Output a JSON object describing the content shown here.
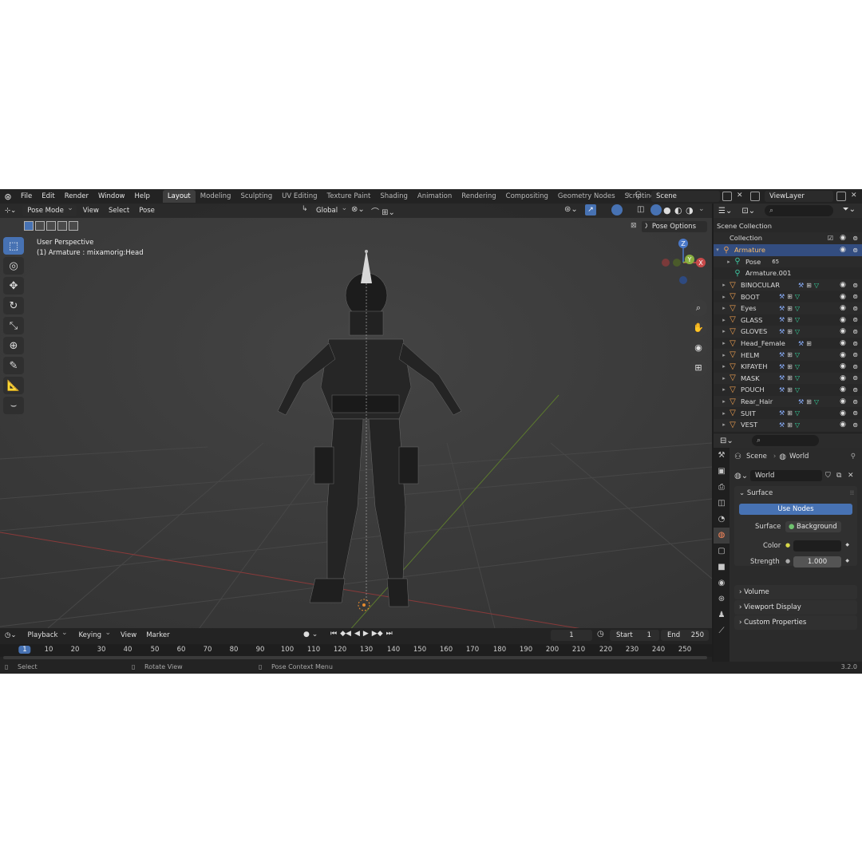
{
  "menu": [
    "File",
    "Edit",
    "Render",
    "Window",
    "Help"
  ],
  "workspaces": [
    "Layout",
    "Modeling",
    "Sculpting",
    "UV Editing",
    "Texture Paint",
    "Shading",
    "Animation",
    "Rendering",
    "Compositing",
    "Geometry Nodes",
    "Scripting"
  ],
  "scene_name": "Scene",
  "view_layer": "ViewLayer",
  "viewport": {
    "mode": "Pose Mode",
    "menus": [
      "View",
      "Select",
      "Pose"
    ],
    "transform_orientation": "Global",
    "perspective_label": "User Perspective",
    "active_bone_label": "(1) Armature : mixamorig:Head",
    "pose_options": "Pose Options",
    "x_label": "X",
    "gizmo_axes": {
      "z": "Z",
      "y": "Y",
      "x": "X"
    }
  },
  "outliner": {
    "root": "Scene Collection",
    "collection": "Collection",
    "rows": [
      {
        "label": "Armature",
        "kind": "armature",
        "selected": true
      },
      {
        "label": "Pose",
        "kind": "pose",
        "badge": "65"
      },
      {
        "label": "Armature.001",
        "kind": "armdata"
      },
      {
        "label": "BINOCULAR",
        "kind": "mesh"
      },
      {
        "label": "BOOT",
        "kind": "mesh"
      },
      {
        "label": "Eyes",
        "kind": "mesh"
      },
      {
        "label": "GLASS",
        "kind": "mesh"
      },
      {
        "label": "GLOVES",
        "kind": "mesh"
      },
      {
        "label": "Head_Female",
        "kind": "mesh"
      },
      {
        "label": "HELM",
        "kind": "mesh"
      },
      {
        "label": "KIFAYEH",
        "kind": "mesh"
      },
      {
        "label": "MASK",
        "kind": "mesh"
      },
      {
        "label": "POUCH",
        "kind": "mesh"
      },
      {
        "label": "Rear_Hair",
        "kind": "mesh"
      },
      {
        "label": "SUIT",
        "kind": "mesh"
      },
      {
        "label": "VEST",
        "kind": "mesh"
      }
    ]
  },
  "properties": {
    "breadcrumb_scene": "Scene",
    "breadcrumb_world": "World",
    "world_name": "World",
    "surface_panel": "Surface",
    "use_nodes": "Use Nodes",
    "surface_label": "Surface",
    "surface_value": "Background",
    "color_label": "Color",
    "strength_label": "Strength",
    "strength_value": "1.000",
    "collapsed_panels": [
      "Volume",
      "Viewport Display",
      "Custom Properties"
    ]
  },
  "timeline": {
    "menus": [
      "Playback",
      "Keying",
      "View",
      "Marker"
    ],
    "current_frame": "1",
    "start_label": "Start",
    "start_value": "1",
    "end_label": "End",
    "end_value": "250",
    "ticks": [
      "1",
      "10",
      "20",
      "30",
      "40",
      "50",
      "60",
      "70",
      "80",
      "90",
      "100",
      "110",
      "120",
      "130",
      "140",
      "150",
      "160",
      "170",
      "180",
      "190",
      "200",
      "210",
      "220",
      "230",
      "240",
      "250"
    ]
  },
  "statusbar": {
    "select": "Select",
    "rotate": "Rotate View",
    "context": "Pose Context Menu",
    "version": "3.2.0"
  }
}
